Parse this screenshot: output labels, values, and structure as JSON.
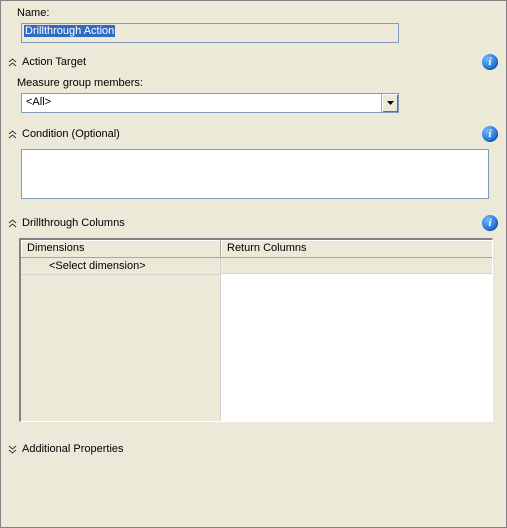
{
  "name_label": "Name:",
  "name_value": "Drillthrough Action",
  "sections": {
    "action_target": {
      "title": "Action Target",
      "measure_label": "Measure group members:",
      "measure_value": "<All>"
    },
    "condition": {
      "title": "Condition (Optional)",
      "value": ""
    },
    "drill_cols": {
      "title": "Drillthrough Columns",
      "col_dimensions": "Dimensions",
      "col_return": "Return Columns",
      "placeholder_row": "<Select dimension>"
    },
    "additional": {
      "title": "Additional Properties"
    }
  },
  "info_glyph": "i"
}
